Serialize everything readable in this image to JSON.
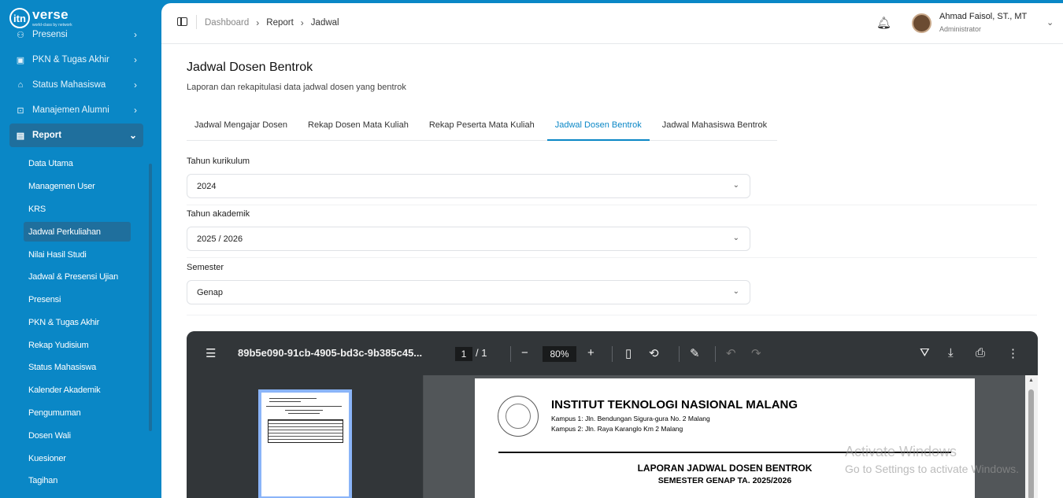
{
  "app": {
    "brand": "verse",
    "brand_prefix": "itn",
    "brand_tagline": "world-class by network"
  },
  "sidebar": {
    "items": [
      {
        "label": "Presensi",
        "icon": "user-check-icon"
      },
      {
        "label": "PKN & Tugas Akhir",
        "icon": "briefcase-icon"
      },
      {
        "label": "Status Mahasiswa",
        "icon": "graduation-icon"
      },
      {
        "label": "Manajemen Alumni",
        "icon": "alumni-icon"
      },
      {
        "label": "Report",
        "icon": "report-icon"
      }
    ],
    "report_items": [
      "Data Utama",
      "Managemen User",
      "KRS",
      "Jadwal Perkuliahan",
      "Nilai Hasil Studi",
      "Jadwal & Presensi Ujian",
      "Presensi",
      "PKN & Tugas Akhir",
      "Rekap Yudisium",
      "Status Mahasiswa",
      "Kalender Akademik",
      "Pengumuman",
      "Dosen Wali",
      "Kuesioner",
      "Tagihan"
    ]
  },
  "breadcrumb": {
    "items": [
      "Dashboard",
      "Report",
      "Jadwal"
    ]
  },
  "user": {
    "name": "Ahmad Faisol, ST., MT",
    "role": "Administrator"
  },
  "page": {
    "title": "Jadwal Dosen Bentrok",
    "subtitle": "Laporan dan rekapitulasi data jadwal dosen yang bentrok"
  },
  "tabs": [
    {
      "label": "Jadwal Mengajar Dosen",
      "active": false
    },
    {
      "label": "Rekap Dosen Mata Kuliah",
      "active": false
    },
    {
      "label": "Rekap Peserta Mata Kuliah",
      "active": false
    },
    {
      "label": "Jadwal Dosen Bentrok",
      "active": true
    },
    {
      "label": "Jadwal Mahasiswa Bentrok",
      "active": false
    }
  ],
  "filters": {
    "kurikulum": {
      "label": "Tahun kurikulum",
      "value": "2024"
    },
    "akademik": {
      "label": "Tahun akademik",
      "value": "2025 / 2026"
    },
    "semester": {
      "label": "Semester",
      "value": "Genap"
    }
  },
  "pdf": {
    "filename": "89b5e090-91cb-4905-bd3c-9b385c45...",
    "page_current": "1",
    "page_total": "/  1",
    "zoom": "80%",
    "doc": {
      "institution": "INSTITUT TEKNOLOGI NASIONAL MALANG",
      "address1": "Kampus 1: Jln. Bendungan Sigura-gura No. 2 Malang",
      "address2": "Kampus 2: Jln. Raya Karanglo Km 2 Malang",
      "report_title": "LAPORAN JADWAL DOSEN BENTROK",
      "report_subtitle": "SEMESTER GENAP TA. 2025/2026"
    }
  },
  "watermark": {
    "line1": "Activate Windows",
    "line2": "Go to Settings to activate Windows."
  }
}
